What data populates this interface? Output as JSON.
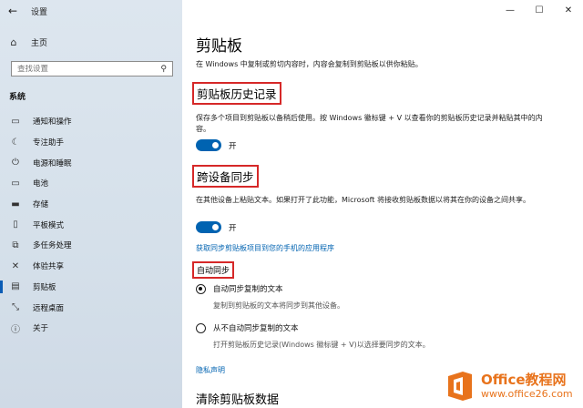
{
  "window": {
    "title": "设置",
    "back": "←",
    "minimize": "—",
    "maximize": "☐",
    "close": "✕"
  },
  "sidebar": {
    "home_label": "主页",
    "search_placeholder": "查找设置",
    "section": "系统",
    "items": [
      {
        "label": "通知和操作",
        "icon": "message-icon"
      },
      {
        "label": "专注助手",
        "icon": "moon-icon"
      },
      {
        "label": "电源和睡眠",
        "icon": "power-icon"
      },
      {
        "label": "电池",
        "icon": "battery-icon"
      },
      {
        "label": "存储",
        "icon": "storage-icon"
      },
      {
        "label": "平板模式",
        "icon": "tablet-icon"
      },
      {
        "label": "多任务处理",
        "icon": "multitask-icon"
      },
      {
        "label": "体验共享",
        "icon": "share-icon"
      },
      {
        "label": "剪贴板",
        "icon": "clipboard-icon",
        "active": true
      },
      {
        "label": "远程桌面",
        "icon": "remote-icon"
      },
      {
        "label": "关于",
        "icon": "info-icon"
      }
    ]
  },
  "main": {
    "title": "剪贴板",
    "description": "在 Windows 中复制或剪切内容时，内容会复制到剪贴板以供你粘贴。",
    "history": {
      "heading": "剪贴板历史记录",
      "text": "保存多个项目到剪贴板以备稍后使用。按 Windows 徽标键 + V 以查看你的剪贴板历史记录并粘贴其中的内容。",
      "toggle_label": "开",
      "toggle_on": true
    },
    "sync": {
      "heading": "跨设备同步",
      "text": "在其他设备上粘贴文本。如果打开了此功能，Microsoft 将接收剪贴板数据以将其在你的设备之间共享。",
      "toggle_label": "开",
      "toggle_on": true,
      "link": "获取同步剪贴板项目到您的手机的应用程序",
      "auto_heading": "自动同步",
      "option1": "自动同步复制的文本",
      "option1_sub": "复制到剪贴板的文本将同步到其他设备。",
      "option2": "从不自动同步复制的文本",
      "option2_sub": "打开剪贴板历史记录(Windows 徽标键 + V)以选择要同步的文本。",
      "selected": "option1"
    },
    "privacy_link": "隐私声明",
    "clear_heading": "清除剪贴板数据"
  },
  "watermark": {
    "brand": "Office教程网",
    "url": "www.office26.com"
  },
  "colors": {
    "accent": "#0063b1",
    "highlight_box": "#d62828",
    "watermark": "#e8731c"
  }
}
